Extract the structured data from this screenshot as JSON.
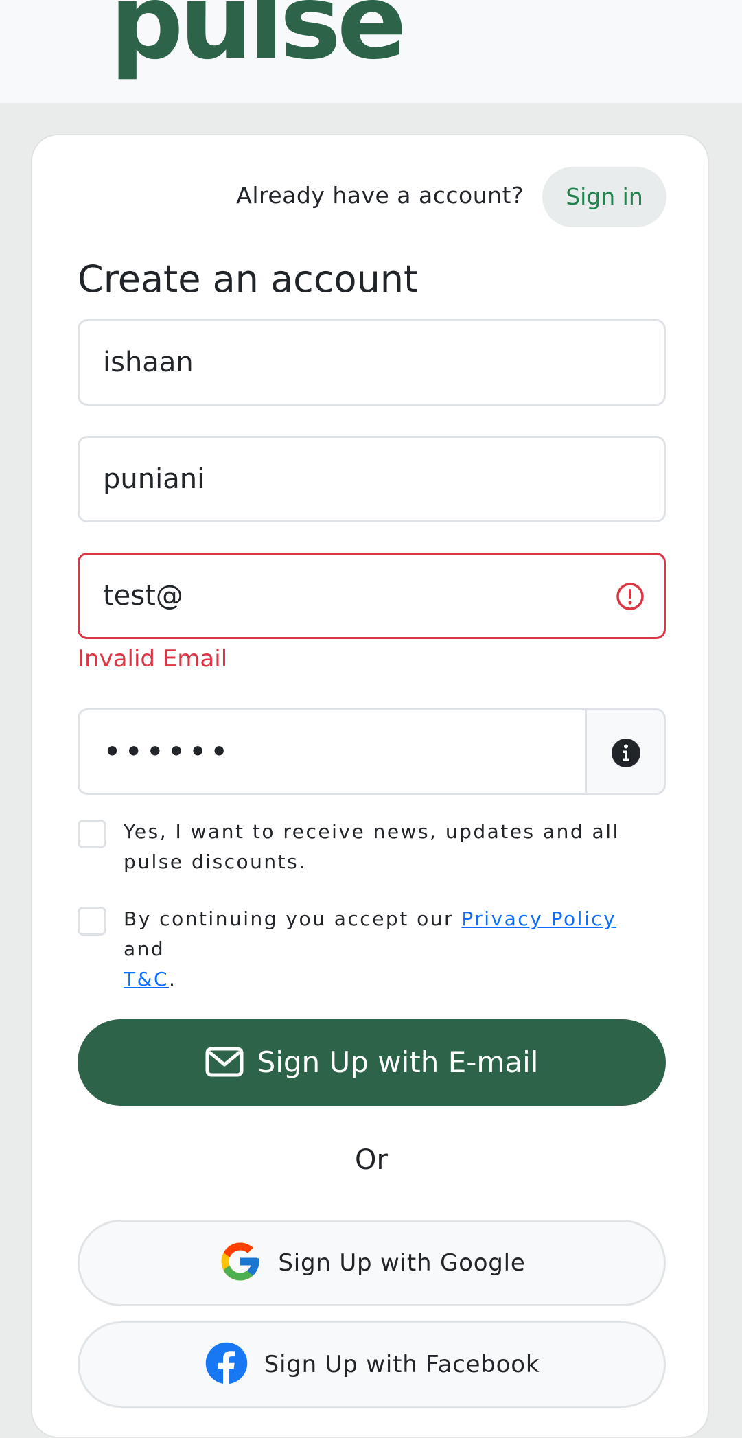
{
  "brand": {
    "logo_text": "pulse",
    "color": "#2c6349"
  },
  "header": {
    "already_text": "Already have a account?",
    "signin_label": "Sign in"
  },
  "form": {
    "title": "Create an account",
    "first_name_value": "ishaan",
    "last_name_value": "puniani",
    "email_value": "test@",
    "email_error": "Invalid Email",
    "password_masked": "••••••",
    "newsletter_label": "Yes, I want to receive news, updates and all pulse discounts.",
    "newsletter_checked": false,
    "terms_prefix": "By continuing you accept our",
    "privacy_link": "Privacy Policy",
    "terms_and": "and",
    "tc_link": "T&C",
    "terms_suffix": ".",
    "terms_checked": false
  },
  "buttons": {
    "email_signup": "Sign Up with E-mail",
    "or_text": "Or",
    "google_signup": "Sign Up with Google",
    "facebook_signup": "Sign Up with Facebook"
  },
  "colors": {
    "primary": "#2c6349",
    "error": "#dc3545",
    "link": "#0d6efd",
    "signin_text": "#23824e"
  },
  "icons": {
    "email_alert": "exclamation-circle-icon",
    "password_info": "info-circle-icon",
    "email_button": "envelope-icon",
    "google": "google-logo-icon",
    "facebook": "facebook-logo-icon"
  }
}
